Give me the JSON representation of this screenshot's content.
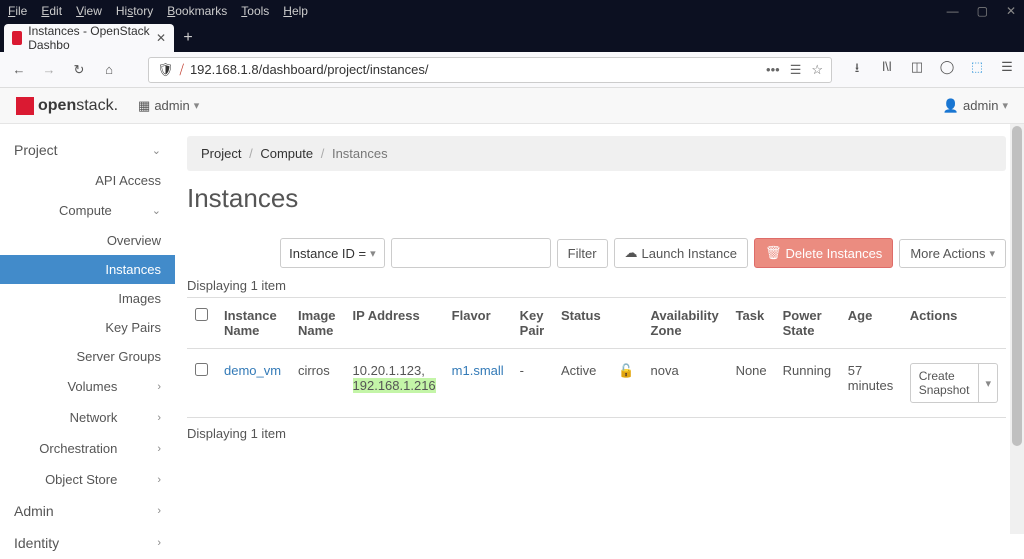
{
  "browser": {
    "menus": [
      "File",
      "Edit",
      "View",
      "History",
      "Bookmarks",
      "Tools",
      "Help"
    ],
    "tab_title": "Instances - OpenStack Dashbo",
    "url": "192.168.1.8/dashboard/project/instances/"
  },
  "header": {
    "brand_bold": "open",
    "brand_rest": "stack.",
    "domain_label": "admin",
    "user_label": "admin"
  },
  "sidebar": {
    "project": "Project",
    "api_access": "API Access",
    "compute": "Compute",
    "overview": "Overview",
    "instances": "Instances",
    "images": "Images",
    "key_pairs": "Key Pairs",
    "server_groups": "Server Groups",
    "volumes": "Volumes",
    "network": "Network",
    "orchestration": "Orchestration",
    "object_store": "Object Store",
    "admin": "Admin",
    "identity": "Identity"
  },
  "breadcrumb": {
    "project": "Project",
    "compute": "Compute",
    "current": "Instances"
  },
  "page": {
    "title": "Instances",
    "filter_field": "Instance ID =",
    "filter_btn": "Filter",
    "launch_btn": "Launch Instance",
    "delete_btn": "Delete Instances",
    "more_btn": "More Actions",
    "count_top": "Displaying 1 item",
    "count_bottom": "Displaying 1 item"
  },
  "table": {
    "headers": {
      "name": "Instance Name",
      "image": "Image Name",
      "ip": "IP Address",
      "flavor": "Flavor",
      "keypair": "Key Pair",
      "status": "Status",
      "az": "Availability Zone",
      "task": "Task",
      "power": "Power State",
      "age": "Age",
      "actions": "Actions"
    },
    "row": {
      "name": "demo_vm",
      "image": "cirros",
      "ip1": "10.20.1.123,",
      "ip2": "192.168.1.216",
      "flavor": "m1.small",
      "keypair": "-",
      "status": "Active",
      "az": "nova",
      "task": "None",
      "power": "Running",
      "age": "57 minutes",
      "action": "Create Snapshot"
    }
  }
}
